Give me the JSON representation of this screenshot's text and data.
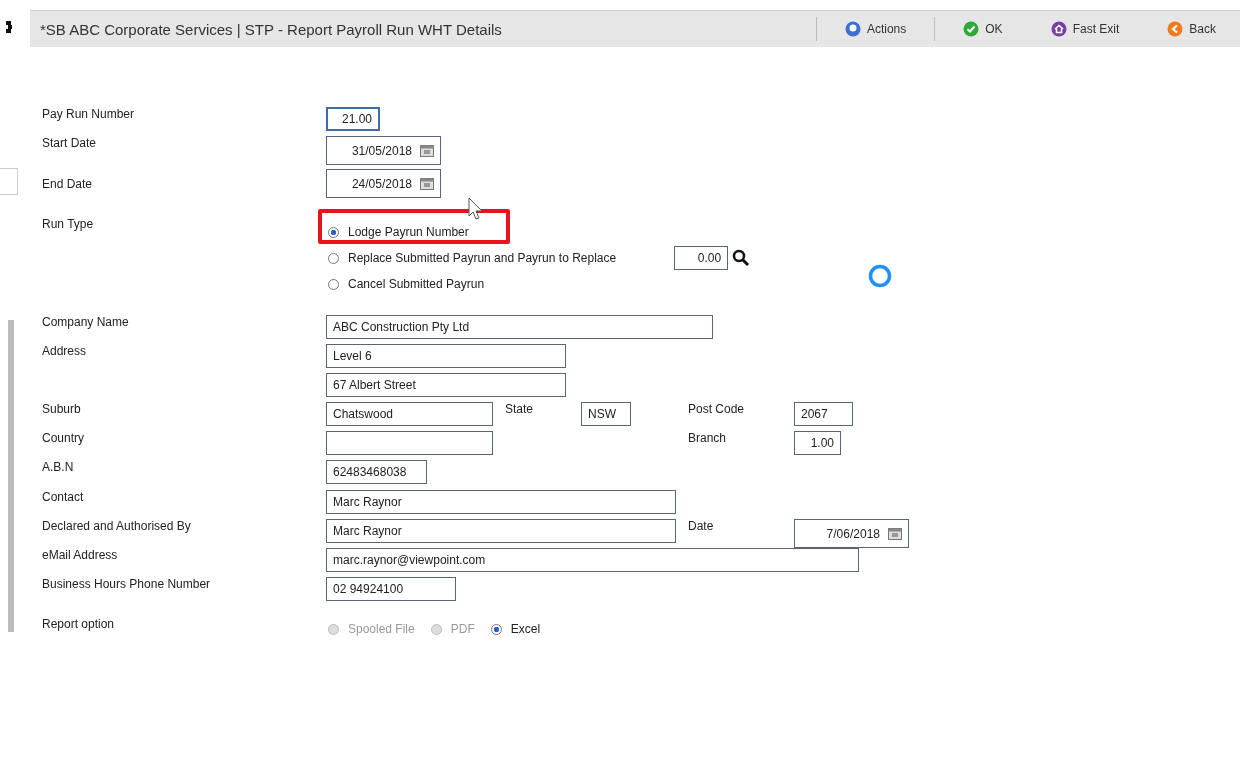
{
  "window": {
    "title": "*SB ABC Corporate Services | STP - Report Payroll Run WHT Details"
  },
  "toolbar": [
    {
      "kind": "actions",
      "label": "Actions"
    },
    {
      "kind": "ok",
      "label": "OK"
    },
    {
      "kind": "exit",
      "label": "Fast Exit"
    },
    {
      "kind": "back",
      "label": "Back"
    }
  ],
  "pay_run_number": {
    "label": "Pay Run Number",
    "value": "21.00"
  },
  "start_date": {
    "label": "Start Date",
    "value": "31/05/2018"
  },
  "end_date": {
    "label": "End Date",
    "value": "24/05/2018"
  },
  "run_type": {
    "label": "Run Type",
    "payrun_to_replace": "0.00",
    "options": [
      {
        "label": "Lodge Payrun Number",
        "selected": true
      },
      {
        "label": "Replace Submitted Payrun and Payrun to Replace",
        "selected": false
      },
      {
        "label": "Cancel Submitted Payrun",
        "selected": false
      }
    ]
  },
  "company_name": {
    "label": "Company Name",
    "value": "ABC Construction Pty Ltd"
  },
  "address": {
    "label": "Address",
    "lines": [
      "Level 6",
      "67 Albert Street"
    ]
  },
  "suburb": {
    "label": "Suburb",
    "value": "Chatswood"
  },
  "state": {
    "label": "State",
    "value": "NSW"
  },
  "post_code": {
    "label": "Post Code",
    "value": "2067"
  },
  "country": {
    "label": "Country"
  },
  "branch": {
    "label": "Branch",
    "value": "1.00"
  },
  "abn": {
    "label": "A.B.N",
    "value": "62483468038"
  },
  "contact": {
    "label": "Contact",
    "value": "Marc Raynor"
  },
  "declared_by": {
    "label": "Declared and Authorised By",
    "value": "Marc Raynor"
  },
  "date": {
    "label": "Date",
    "value": "7/06/2018"
  },
  "email": {
    "label": "eMail Address",
    "value": "marc.raynor@viewpoint.com"
  },
  "phone": {
    "label": "Business Hours Phone Number",
    "value": "02 94924100"
  },
  "report_option": {
    "label": "Report option",
    "options": [
      {
        "label": "Spooled File",
        "selected": false,
        "disabled": true
      },
      {
        "label": "PDF",
        "selected": false,
        "disabled": true
      },
      {
        "label": "Excel",
        "selected": true,
        "disabled": false
      }
    ]
  }
}
